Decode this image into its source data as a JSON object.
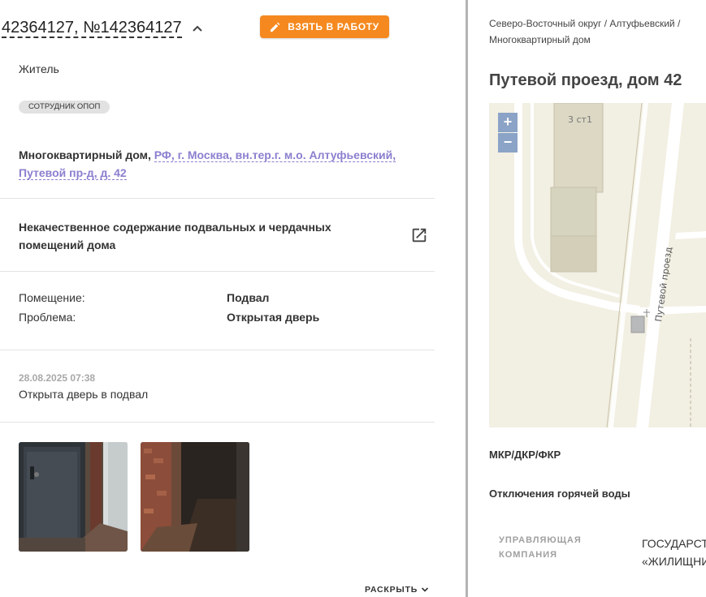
{
  "ticket": {
    "title": "42364127, №142364127",
    "take_button": "ВЗЯТЬ В РАБОТУ",
    "role": "Житель",
    "badge": "Сотрудник ОПОП",
    "address_type": "Многоквартирный дом,",
    "address_link": "РФ, г. Москва, вн.тер.г. м.о. Алтуфьевский, Путевой пр-д, д. 42",
    "problem_title": "Некачественное содержание подвальных и чердачных помещений дома",
    "premise_label": "Помещение:",
    "premise_value": "Подвал",
    "issue_label": "Проблема:",
    "issue_value": "Открытая дверь",
    "timestamp": "28.08.2025 07:38",
    "comment": "Открыта дверь в подвал",
    "expand_label": "РАСКРЫТЬ"
  },
  "right_panel": {
    "breadcrumb": "Северо-Восточный округ / Алтуфьевский / Многоквартирный дом",
    "title": "Путевой проезд, дом 42",
    "map": {
      "zoom_in": "+",
      "zoom_out": "−",
      "building_label": "3 ст1",
      "street_label": "Путевой проезд"
    },
    "section_mkr": "МКР/ДКР/ФКР",
    "section_hot_water": "Отключения горячей воды",
    "management_label": "УПРАВЛЯЮЩАЯ КОМПАНИЯ",
    "management_value_line1": "ГОСУДАРСТ",
    "management_value_line2": "«ЖИЛИЩНИ"
  },
  "colors": {
    "accent_button": "#f5891f",
    "link": "#8a7fcf",
    "map_zoom": "#8aa3c6"
  },
  "icons": [
    "pencil-icon",
    "chevron-up-icon",
    "external-link-icon",
    "chevron-down-icon"
  ]
}
